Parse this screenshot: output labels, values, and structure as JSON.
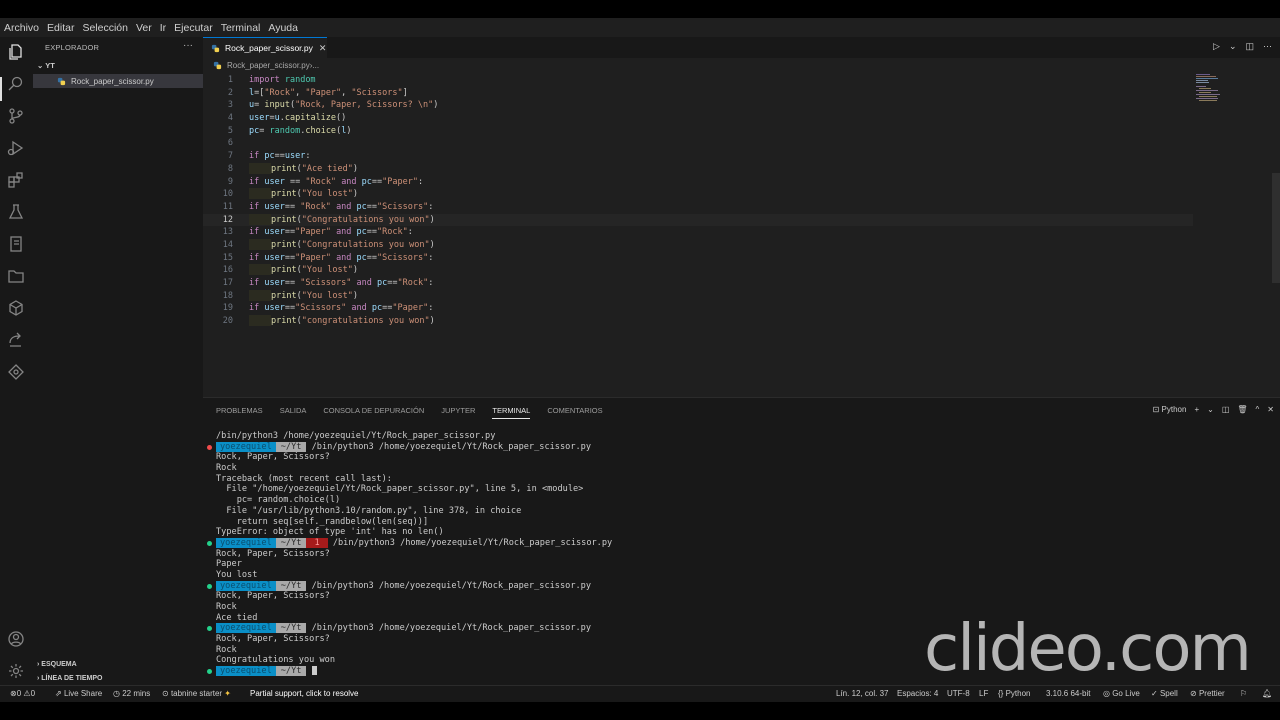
{
  "menu": [
    "Archivo",
    "Editar",
    "Selección",
    "Ver",
    "Ir",
    "Ejecutar",
    "Terminal",
    "Ayuda"
  ],
  "sidebar": {
    "title": "EXPLORADOR",
    "more": "···",
    "folder": "YT",
    "file": "Rock_paper_scissor.py",
    "outline": "ESQUEMA",
    "timeline": "LÍNEA DE TIEMPO"
  },
  "activity_icons": [
    "explorer-icon",
    "search-icon",
    "source-control-icon",
    "run-debug-icon",
    "extensions-icon",
    "testing-icon",
    "notebook-icon",
    "folder-icon",
    "remote-icon",
    "live-share-icon",
    "docker-icon",
    "account-icon",
    "settings-gear-icon"
  ],
  "editor": {
    "tab": "Rock_paper_scissor.py",
    "breadcrumb_file": "Rock_paper_scissor.py",
    "breadcrumb_more": "...",
    "current_line": 12,
    "lines": [
      "import random",
      "l=[\"Rock\", \"Paper\", \"Scissors\"]",
      "u= input(\"Rock, Paper, Scissors? \\n\")",
      "user=u.capitalize()",
      "pc= random.choice(l)",
      "",
      "if pc==user:",
      "    print(\"Ace tied\")",
      "if user == \"Rock\" and pc==\"Paper\":",
      "    print(\"You lost\")",
      "if user== \"Rock\" and pc==\"Scissors\":",
      "    print(\"Congratulations you won\")",
      "if user==\"Paper\" and pc==\"Rock\":",
      "    print(\"Congratulations you won\")",
      "if user==\"Paper\" and pc==\"Scissors\":",
      "    print(\"You lost\")",
      "if user== \"Scissors\" and pc==\"Rock\":",
      "    print(\"You lost\")",
      "if user==\"Scissors\" and pc==\"Paper\":",
      "    print(\"congratulations you won\")"
    ]
  },
  "panel": {
    "tabs": [
      "PROBLEMAS",
      "SALIDA",
      "CONSOLA DE DEPURACIÓN",
      "JUPYTER",
      "TERMINAL",
      "COMENTARIOS"
    ],
    "active_tab": "TERMINAL",
    "shell_label": "Python"
  },
  "terminal": [
    {
      "type": "text",
      "text": "/bin/python3 /home/yoezequiel/Yt/Rock_paper_scissor.py"
    },
    {
      "type": "prompt",
      "dot": "err",
      "user": "yoezequiel",
      "dir": "~/Yt",
      "cmd": " /bin/python3 /home/yoezequiel/Yt/Rock_paper_scissor.py"
    },
    {
      "type": "text",
      "text": "Rock, Paper, Scissors?"
    },
    {
      "type": "text",
      "text": "Rock"
    },
    {
      "type": "text",
      "text": "Traceback (most recent call last):"
    },
    {
      "type": "text",
      "text": "  File \"/home/yoezequiel/Yt/Rock_paper_scissor.py\", line 5, in <module>"
    },
    {
      "type": "text",
      "text": "    pc= random.choice(l)"
    },
    {
      "type": "text",
      "text": "  File \"/usr/lib/python3.10/random.py\", line 378, in choice"
    },
    {
      "type": "text",
      "text": "    return seq[self._randbelow(len(seq))]"
    },
    {
      "type": "text",
      "text": "TypeError: object of type 'int' has no len()"
    },
    {
      "type": "prompt",
      "dot": "ok",
      "user": "yoezequiel",
      "dir": "~/Yt",
      "err": "1",
      "cmd": " /bin/python3 /home/yoezequiel/Yt/Rock_paper_scissor.py"
    },
    {
      "type": "text",
      "text": "Rock, Paper, Scissors?"
    },
    {
      "type": "text",
      "text": "Paper"
    },
    {
      "type": "text",
      "text": "You lost"
    },
    {
      "type": "prompt",
      "dot": "ok",
      "user": "yoezequiel",
      "dir": "~/Yt",
      "cmd": " /bin/python3 /home/yoezequiel/Yt/Rock_paper_scissor.py"
    },
    {
      "type": "text",
      "text": "Rock, Paper, Scissors?"
    },
    {
      "type": "text",
      "text": "Rock"
    },
    {
      "type": "text",
      "text": "Ace tied"
    },
    {
      "type": "prompt",
      "dot": "ok",
      "user": "yoezequiel",
      "dir": "~/Yt",
      "cmd": " /bin/python3 /home/yoezequiel/Yt/Rock_paper_scissor.py"
    },
    {
      "type": "text",
      "text": "Rock, Paper, Scissors?"
    },
    {
      "type": "text",
      "text": "Rock"
    },
    {
      "type": "text",
      "text": "Congratulations you won"
    },
    {
      "type": "prompt",
      "dot": "ok",
      "user": "yoezequiel",
      "dir": "~/Yt",
      "cmd": " ",
      "cursor": true
    }
  ],
  "watermark": "clideo.com",
  "status": {
    "errors": "0",
    "warnings": "0",
    "live_share": "Live Share",
    "timer": "22 mins",
    "tabnine": "tabnine starter",
    "partial": "Partial support, click to resolve",
    "position": "Lín. 12, col. 37",
    "spaces": "Espacios: 4",
    "encoding": "UTF-8",
    "eol": "LF",
    "language": "Python",
    "interpreter": "3.10.6 64-bit",
    "go_live": "Go Live",
    "spell": "Spell",
    "prettier": "Prettier"
  }
}
